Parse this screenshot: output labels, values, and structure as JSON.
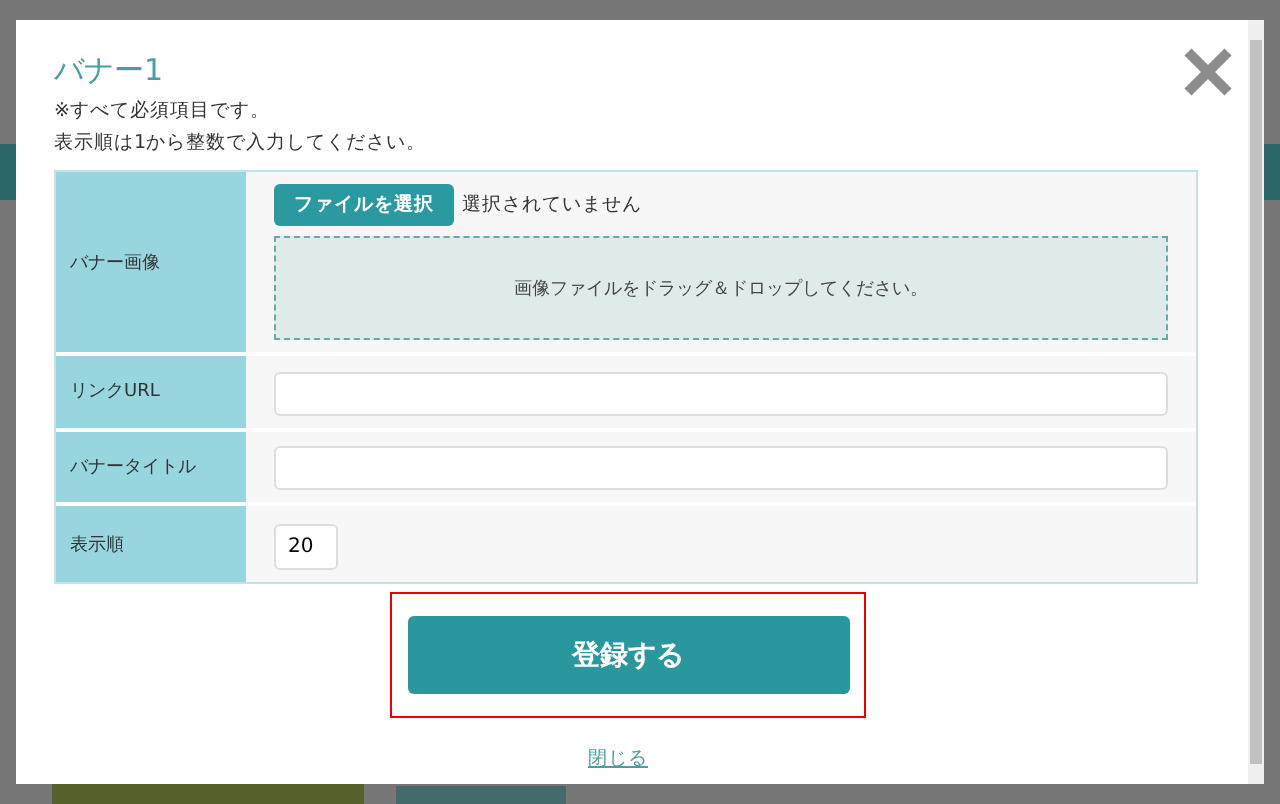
{
  "modal": {
    "title": "バナー1",
    "notes": [
      "※すべて必須項目です。",
      "表示順は1から整数で入力してください。"
    ],
    "fields": [
      {
        "kind": "file",
        "label": "バナー画像",
        "button": "ファイルを選択",
        "status": "選択されていません",
        "dropzone": "画像ファイルをドラッグ＆ドロップしてください。"
      },
      {
        "kind": "text",
        "label": "リンクURL"
      },
      {
        "kind": "text",
        "label": "バナータイトル"
      },
      {
        "kind": "number",
        "label": "表示順",
        "value": "20"
      }
    ],
    "submit": "登録する",
    "close": "閉じる"
  }
}
